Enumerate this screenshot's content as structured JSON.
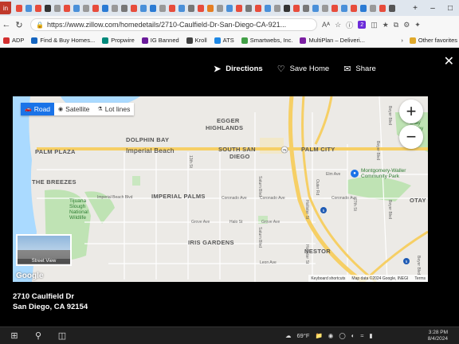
{
  "browser": {
    "first_tab_label": "in",
    "url": "https://www.zillow.com/homedetails/2710-Caulfield-Dr-San-Diego-CA-921...",
    "tab_colors": [
      "#e74c3c",
      "#4a90d9",
      "#e74c3c",
      "#333333",
      "#999999",
      "#e74c3c",
      "#4a90d9",
      "#999999",
      "#e74c3c",
      "#2b7bd4",
      "#999999",
      "#777777",
      "#e74c3c",
      "#4a90d9",
      "#2b7bd4",
      "#999999",
      "#e74c3c",
      "#4a90d9",
      "#777777",
      "#e74c3c",
      "#e67e22",
      "#999999",
      "#4a90d9",
      "#e74c3c",
      "#777777",
      "#e74c3c",
      "#4a90d9",
      "#999999",
      "#333333",
      "#e74c3c",
      "#777777",
      "#4a90d9",
      "#999999",
      "#e74c3c",
      "#4a90d9",
      "#e74c3c",
      "#2b7bd4",
      "#999999",
      "#e74c3c",
      "#555555"
    ],
    "new_tab": "+",
    "reader_icon": "Aᴬ",
    "badge_count": "2"
  },
  "bookmarks": {
    "items": [
      {
        "label": "ADP",
        "color": "#d32f2f"
      },
      {
        "label": "Find & Buy Homes...",
        "color": "#1565c0"
      },
      {
        "label": "Propwire",
        "color": "#00897b"
      },
      {
        "label": "IG Banned",
        "color": "#6a1b9a"
      },
      {
        "label": "Kroll",
        "color": "#424242"
      },
      {
        "label": "ATS",
        "color": "#1e88e5"
      },
      {
        "label": "Smartwebs, Inc.",
        "color": "#43a047"
      },
      {
        "label": "MultiPlan – Deliveri...",
        "color": "#7b1fa2"
      }
    ],
    "more": "›",
    "other": "Other favorites"
  },
  "modal": {
    "directions": "Directions",
    "save_home": "Save Home",
    "share": "Share",
    "close": "✕"
  },
  "map": {
    "tabs": [
      "Road",
      "Satellite",
      "Lot lines"
    ],
    "zoom_in": "+",
    "zoom_out": "−",
    "places": {
      "egger": "EGGER",
      "highlands": "HIGHLANDS",
      "dolphin_bay": "DOLPHIN BAY",
      "palm_plaza": "PALM PLAZA",
      "imperial_beach": "Imperial Beach",
      "south_san": "SOUTH SAN",
      "diego": "DIEGO",
      "palm_city": "PALM CITY",
      "the_breezes": "THE BREEZES",
      "imperial_palms": "IMPERIAL PALMS",
      "iris_gardens": "IRIS GARDENS",
      "nestor": "NESTOR",
      "otay": "OTAY",
      "otay2": "OTAY",
      "otay3": "OTAY"
    },
    "streets": {
      "imperial_beach_blvd": "Imperial Beach Blvd",
      "coronado_ave1": "Coronado Ave",
      "coronado_ave2": "Coronado Ave",
      "coronado_ave3": "Coronado Ave",
      "grove_ave1": "Grove Ave",
      "grove_ave2": "Grove Ave",
      "halo_st": "Halo St",
      "leon_ave": "Leon Ave",
      "elm_ave": "Elm Ave",
      "thirteenth_st": "13th St",
      "saturn_blvd": "Saturn Blvd",
      "saturn_blvd2": "Saturn Blvd",
      "hollister_st": "Hollister St",
      "hollister_st2": "Hollister St",
      "outer_rd": "Outer Rd",
      "twenty_seventh": "27th St",
      "beyer_blvd": "Beyer Blvd",
      "beyer_blvd2": "Beyer Blvd",
      "beyer_blvd3": "Beyer Blvd",
      "beyer_blvd4": "Beyer Blvd"
    },
    "pois": {
      "tijuana_slough": "Tijuana\nSlough\nNational\nWildlife",
      "montgomery": "Montgomery-Waller\nCommunity Park",
      "otay_valley": "Otay\nValley\nReg",
      "lu": "Lu",
      "pe": "Pe"
    },
    "highway_labels": [
      "75",
      "5",
      "5"
    ],
    "street_view": "Street View",
    "google": "Google",
    "attribution": {
      "shortcuts": "Keyboard shortcuts",
      "data": "Map data ©2024 Google, INEGI",
      "terms": "Terms"
    },
    "colors": {
      "water": "#aadaff",
      "highway": "#f6cf65",
      "park": "#bfe3b4",
      "accent": "#1a73e8"
    }
  },
  "address": {
    "line1": "2710 Caulfield Dr",
    "line2": "San Diego, CA 92154"
  },
  "taskbar": {
    "weather": "69°F",
    "time": "3:28 PM",
    "date": "8/4/2024"
  }
}
